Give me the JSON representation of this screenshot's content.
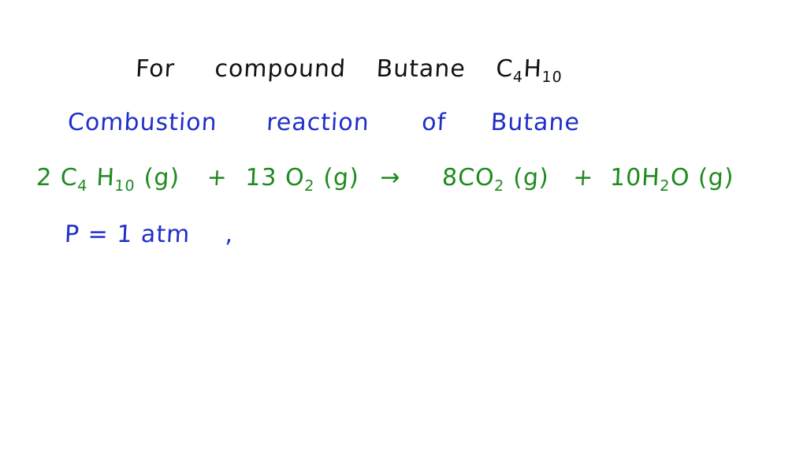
{
  "title": {
    "prefix": "For",
    "word1": "compound",
    "word2": "Butane",
    "formula": {
      "c": "C",
      "c_sub": "4",
      "h": "H",
      "h_sub": "10"
    }
  },
  "subtitle": {
    "w1": "Combustion",
    "w2": "reaction",
    "w3": "of",
    "w4": "Butane"
  },
  "equation": {
    "coef1": "2",
    "r1": {
      "c": "C",
      "c_sub": "4",
      "h": "H",
      "h_sub": "10",
      "state": "(g)"
    },
    "plus1": "+",
    "coef2": "13",
    "r2": {
      "o": "O",
      "o_sub": "2",
      "state": "(g)"
    },
    "arrow": "→",
    "coef3": "8",
    "p1": {
      "c": "CO",
      "o_sub": "2",
      "state": "(g)"
    },
    "plus2": "+",
    "coef4": "10",
    "p2": {
      "h": "H",
      "h_sub": "2",
      "o": "O",
      "state": "(g)"
    }
  },
  "pressure": {
    "label": "P",
    "equals": "=",
    "value": "1 atm",
    "trailing": ","
  },
  "colors": {
    "title": "#111111",
    "subtitle": "#1f2fc8",
    "equation": "#1f8a1f",
    "pressure": "#1f2fc8"
  }
}
